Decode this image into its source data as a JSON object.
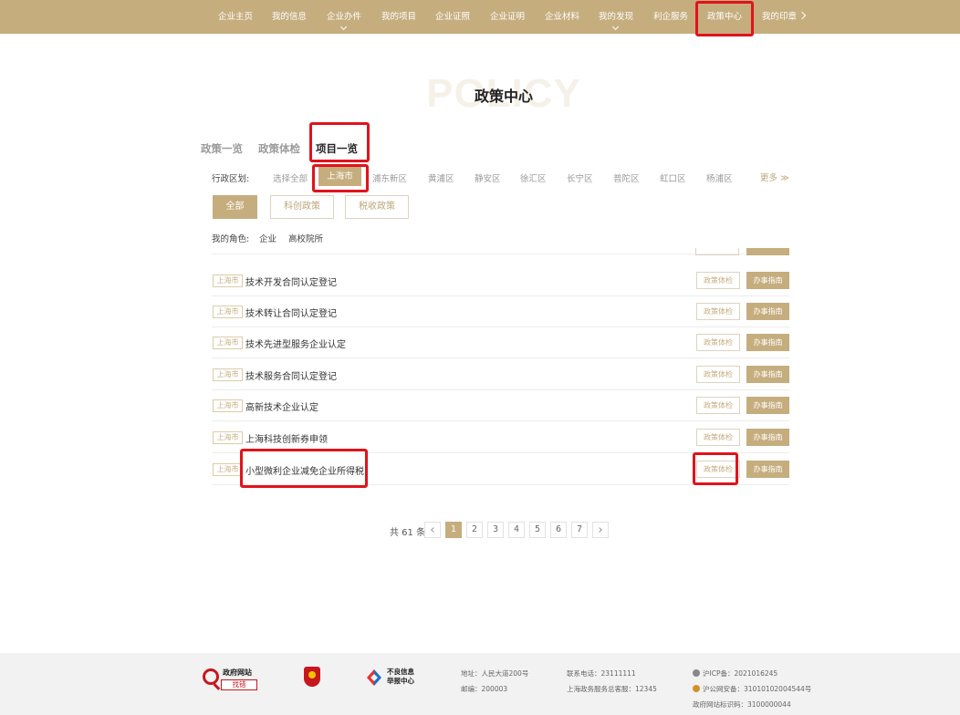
{
  "nav": {
    "items": [
      "企业主页",
      "我的信息",
      "企业办件",
      "我的项目",
      "企业证照",
      "企业证明",
      "企业材料",
      "我的发现",
      "利企服务",
      "政策中心",
      "我的印章"
    ],
    "active": "政策中心"
  },
  "header": {
    "bg_word": "POLICY",
    "title": "政策中心"
  },
  "tabs": [
    "政策一览",
    "政策体检",
    "项目一览"
  ],
  "region": {
    "label": "行政区划:",
    "items": [
      "选择全部",
      "上海市",
      "浦东新区",
      "黄浦区",
      "静安区",
      "徐汇区",
      "长宁区",
      "普陀区",
      "虹口区",
      "杨浦区"
    ],
    "active": "上海市",
    "more": "更多 ≫"
  },
  "categories": [
    "全部",
    "科创政策",
    "税收政策"
  ],
  "role": {
    "label": "我的角色:",
    "items": [
      "企业",
      "高校院所"
    ]
  },
  "list": {
    "tag": "上海市",
    "check_label": "政策体检",
    "guide_label": "办事指南",
    "items": [
      "技术开发合同认定登记",
      "技术转让合同认定登记",
      "技术先进型服务企业认定",
      "技术服务合同认定登记",
      "高新技术企业认定",
      "上海科技创新券申领",
      "小型微利企业减免企业所得税"
    ]
  },
  "pagination": {
    "total": "共 61 条",
    "pages": [
      "1",
      "2",
      "3",
      "4",
      "5",
      "6",
      "7"
    ],
    "current": "1"
  },
  "footer": {
    "logo1_line1": "政府网站",
    "logo1_line2": "找错",
    "report_line1": "不良信息",
    "report_line2": "举报中心",
    "address": "地址：人民大道200号",
    "postcode": "邮编：200003",
    "phone": "联系电话：23111111",
    "hotline": "上海政务服务总客服：12345",
    "icp": "沪ICP备：2021016245",
    "police": "沪公网安备：31010102004544号",
    "site_code": "政府网站标识码：3100000044"
  },
  "colors": {
    "gold": "#c5ad7e",
    "highlight": "#e0131b"
  }
}
